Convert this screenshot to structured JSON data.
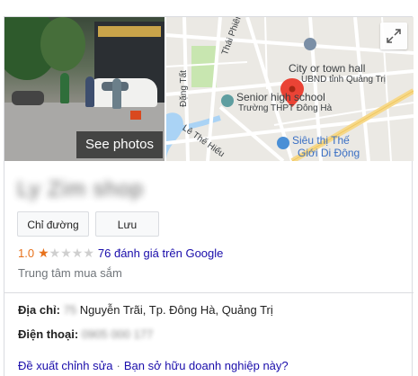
{
  "photo": {
    "see_photos_label": "See photos"
  },
  "map": {
    "labels": {
      "thai_phien": "Thái Phiên",
      "dang_tat": "Đặng Tất",
      "le_the_hieu": "Lê Thế Hiếu",
      "city_hall_1": "City or town hall",
      "city_hall_2": "UBND tỉnh Quảng Trị",
      "school_1": "Senior high school",
      "school_2": "Trường THPT Đông Hà",
      "supermarket_1": "Siêu thị Thế",
      "supermarket_2": "Giới Di Động"
    },
    "colors": {
      "pin": "#ea4335",
      "park": "#c8e6b0",
      "water": "#aad3f5",
      "road": "#ffffff",
      "main_road": "#f6d88a"
    }
  },
  "business": {
    "name": "Ly Zim shop",
    "actions": {
      "directions": "Chỉ đường",
      "save": "Lưu"
    },
    "rating": {
      "value": "1.0",
      "stars": 1,
      "max": 5,
      "reviews": "76 đánh giá trên Google"
    },
    "category": "Trung tâm mua sắm",
    "address_label": "Địa chỉ:",
    "address_number": "75",
    "address_value": "Nguyễn Trãi, Tp. Đông Hà, Quảng Trị",
    "phone_label": "Điện thoại:",
    "phone_value": "0905 000 177"
  },
  "footer": {
    "suggest_edit": "Đề xuất chỉnh sửa",
    "separator": "·",
    "own_business": "Bạn sở hữu doanh nghiệp này?"
  }
}
